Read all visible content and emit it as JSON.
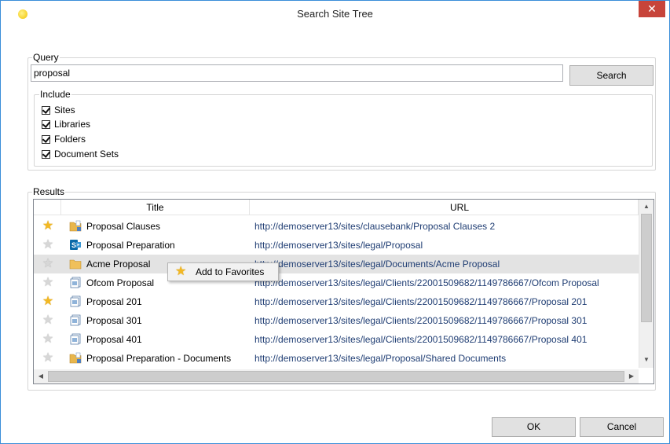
{
  "window": {
    "title": "Search Site Tree",
    "close_glyph": "✕"
  },
  "query": {
    "legend": "Query",
    "value": "proposal",
    "search_label": "Search"
  },
  "include": {
    "legend": "Include",
    "options": [
      {
        "label": "Sites",
        "checked": true
      },
      {
        "label": "Libraries",
        "checked": true
      },
      {
        "label": "Folders",
        "checked": true
      },
      {
        "label": "Document Sets",
        "checked": true
      }
    ]
  },
  "results": {
    "legend": "Results",
    "columns": {
      "title": "Title",
      "url": "URL"
    },
    "rows": [
      {
        "favorite": true,
        "icon": "library-folder-icon",
        "title": "Proposal Clauses",
        "url": "http://demoserver13/sites/clausebank/Proposal Clauses 2"
      },
      {
        "favorite": false,
        "icon": "sharepoint-site-icon",
        "title": "Proposal Preparation",
        "url": "http://demoserver13/sites/legal/Proposal"
      },
      {
        "favorite": false,
        "icon": "folder-icon",
        "title": "Acme Proposal",
        "url": "http://demoserver13/sites/legal/Documents/Acme Proposal"
      },
      {
        "favorite": false,
        "icon": "document-set-icon",
        "title": "Ofcom Proposal",
        "url": "http://demoserver13/sites/legal/Clients/22001509682/1149786667/Ofcom Proposal"
      },
      {
        "favorite": true,
        "icon": "document-set-icon",
        "title": "Proposal 201",
        "url": "http://demoserver13/sites/legal/Clients/22001509682/1149786667/Proposal 201"
      },
      {
        "favorite": false,
        "icon": "document-set-icon",
        "title": "Proposal 301",
        "url": "http://demoserver13/sites/legal/Clients/22001509682/1149786667/Proposal 301"
      },
      {
        "favorite": false,
        "icon": "document-set-icon",
        "title": "Proposal 401",
        "url": "http://demoserver13/sites/legal/Clients/22001509682/1149786667/Proposal 401"
      },
      {
        "favorite": false,
        "icon": "library-folder-icon",
        "title": "Proposal Preparation - Documents",
        "url": "http://demoserver13/sites/legal/Proposal/Shared Documents"
      }
    ]
  },
  "context_menu": {
    "item_label": "Add to Favorites"
  },
  "footer": {
    "ok_label": "OK",
    "cancel_label": "Cancel"
  },
  "colors": {
    "accent": "#3a8ed9",
    "close": "#c7443a",
    "star": "#f2b823",
    "url_text": "#1f3d73",
    "highlight": "#e3e3e3"
  }
}
